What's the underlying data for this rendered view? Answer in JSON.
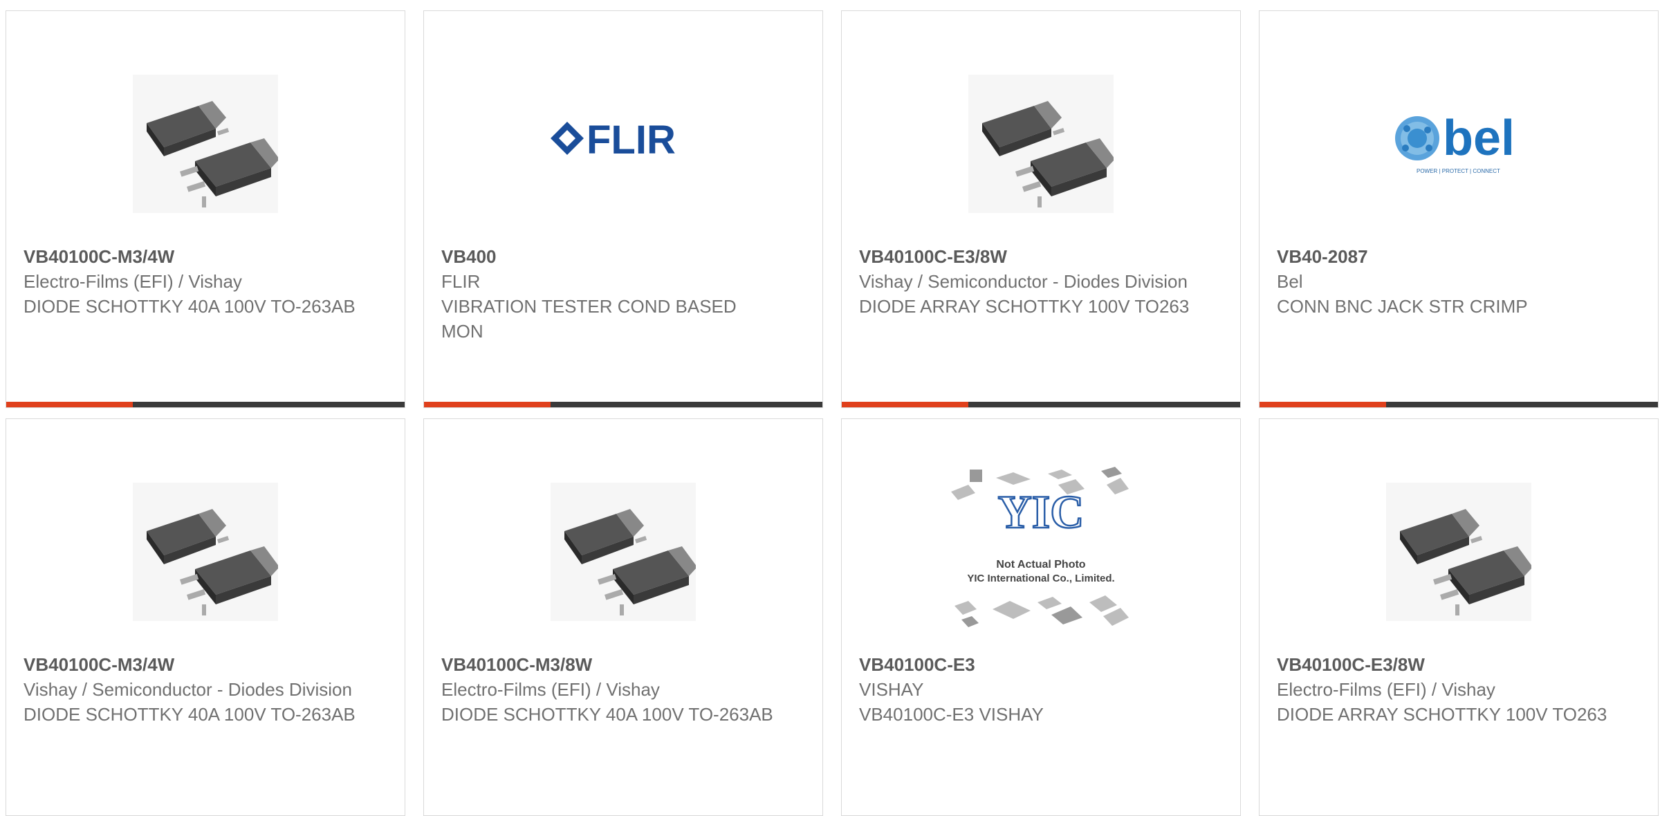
{
  "accent_color": "#e0401c",
  "bar_color": "#3a3a3a",
  "cards": [
    {
      "part": "VB40100C-M3/4W",
      "manufacturer": "Electro-Films (EFI) / Vishay",
      "description": "DIODE SCHOTTKY 40A 100V TO-263AB",
      "image": "package-icon"
    },
    {
      "part": "VB400",
      "manufacturer": "FLIR",
      "description": "VIBRATION TESTER COND BASED MON",
      "image": "flir-logo",
      "logo_text": "FLIR"
    },
    {
      "part": "VB40100C-E3/8W",
      "manufacturer": "Vishay / Semiconductor - Diodes Division",
      "description": "DIODE ARRAY SCHOTTKY 100V TO263",
      "image": "package-icon"
    },
    {
      "part": "VB40-2087",
      "manufacturer": "Bel",
      "description": "CONN BNC JACK STR CRIMP",
      "image": "bel-logo",
      "logo_text": "bel",
      "logo_tagline": "POWER | PROTECT | CONNECT"
    },
    {
      "part": "VB40100C-M3/4W",
      "manufacturer": "Vishay / Semiconductor - Diodes Division",
      "description": "DIODE SCHOTTKY 40A 100V TO-263AB",
      "image": "package-icon"
    },
    {
      "part": "VB40100C-M3/8W",
      "manufacturer": "Electro-Films (EFI) / Vishay",
      "description": "DIODE SCHOTTKY 40A 100V TO-263AB",
      "image": "package-icon"
    },
    {
      "part": "VB40100C-E3",
      "manufacturer": "VISHAY",
      "description": "VB40100C-E3 VISHAY",
      "image": "not-actual-photo",
      "logo_text": "YIC",
      "photo_note_1": "Not Actual Photo",
      "photo_note_2": "YIC International Co., Limited."
    },
    {
      "part": "VB40100C-E3/8W",
      "manufacturer": "Electro-Films (EFI) / Vishay",
      "description": "DIODE ARRAY SCHOTTKY 100V TO263",
      "image": "package-icon"
    }
  ]
}
